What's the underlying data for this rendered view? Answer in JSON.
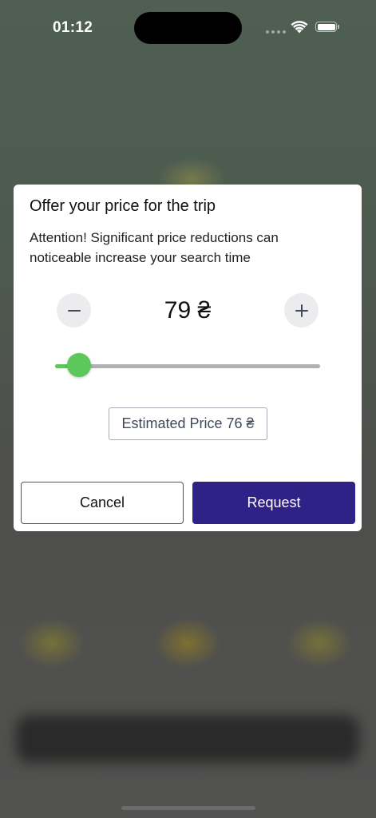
{
  "status_bar": {
    "time": "01:12"
  },
  "dialog": {
    "title": "Offer your price for the trip",
    "message": "Attention! Significant price reductions can noticeable increase your search time",
    "price": {
      "value": "79 ₴",
      "decrease_icon": "minus-icon",
      "increase_icon": "plus-icon"
    },
    "slider": {
      "level": 0.09
    },
    "estimate": {
      "label": "Estimated Price",
      "value": "76 ₴"
    },
    "buttons": {
      "cancel": "Cancel",
      "request": "Request"
    }
  },
  "colors": {
    "accent": "#2f2185",
    "slider_active": "#5cc85c",
    "track": "#b0b0b0"
  }
}
